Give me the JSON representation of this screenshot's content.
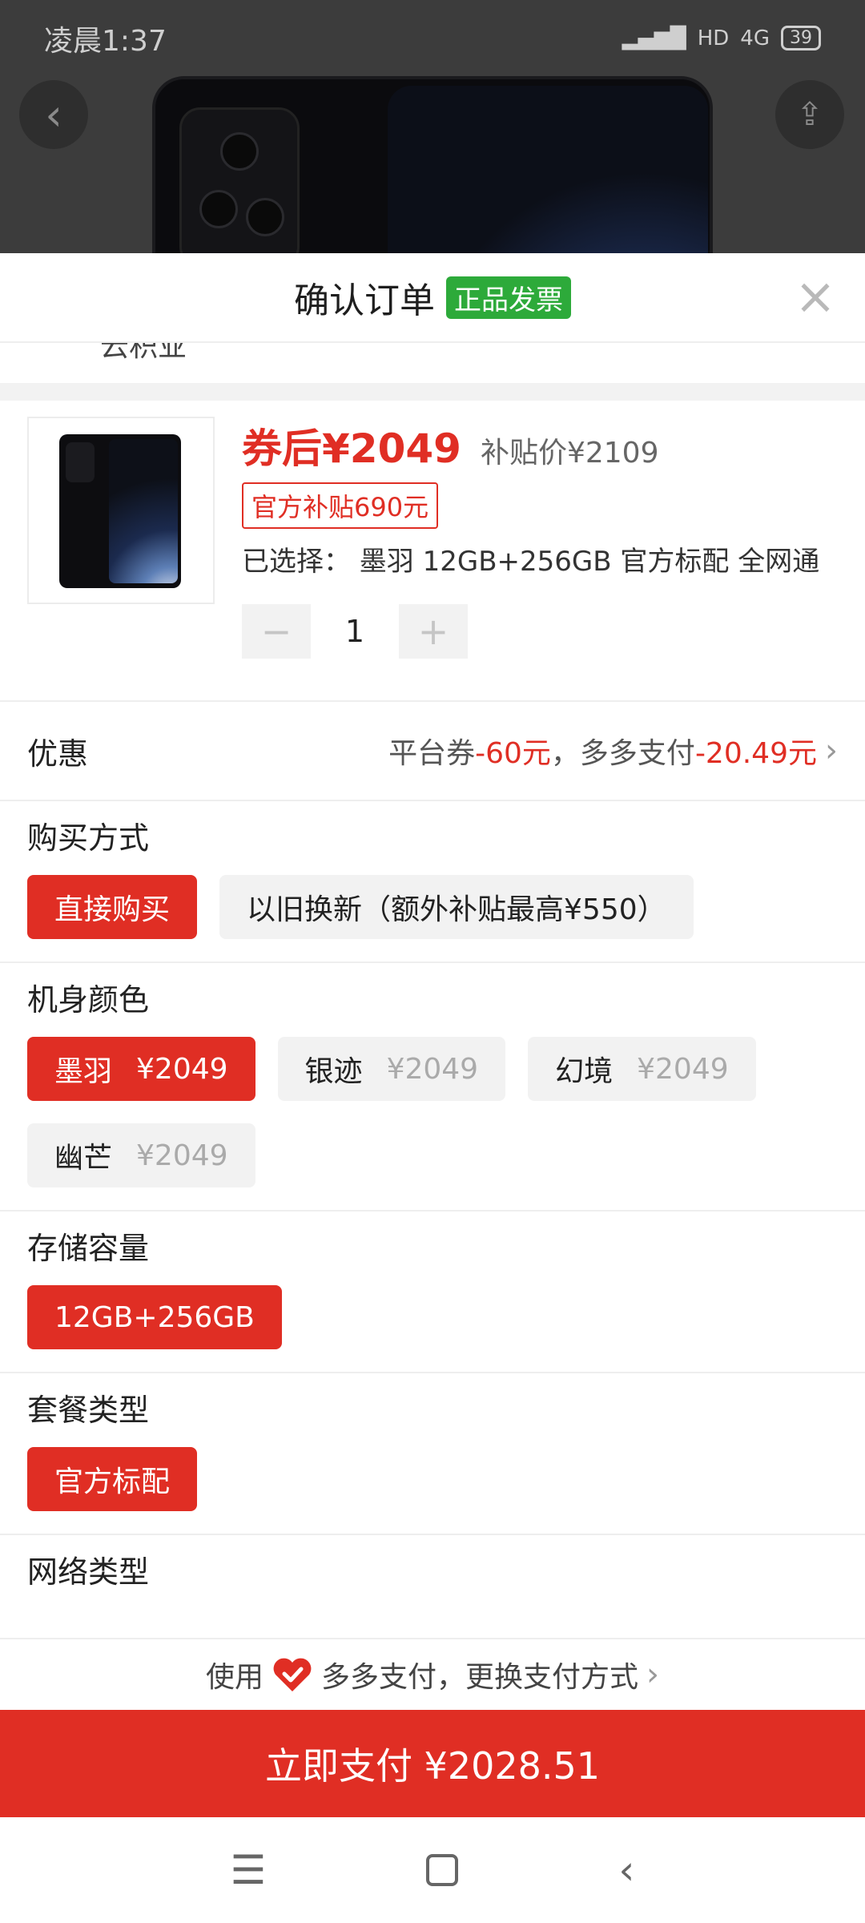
{
  "status_bar": {
    "time": "凌晨1:37",
    "signal_label": "HD",
    "network": "4G",
    "battery": "39"
  },
  "sheet": {
    "title": "确认订单",
    "invoice_badge": "正品发票",
    "cut_text": "云积业"
  },
  "product": {
    "price_label": "券后¥2049",
    "subsidy_price": "补贴价¥2109",
    "subsidy_tag": "官方补贴690元",
    "selected_spec": "已选择： 墨羽 12GB+256GB 官方标配 全网通",
    "quantity": "1",
    "minus": "−",
    "plus": "+"
  },
  "discount": {
    "label": "优惠",
    "coupon_prefix": "平台券",
    "coupon_value": "-60元",
    "pay_prefix": "，多多支付",
    "pay_value": "-20.49元"
  },
  "purchase_method": {
    "title": "购买方式",
    "options": [
      "直接购买",
      "以旧换新（额外补贴最高¥550）"
    ]
  },
  "colors": {
    "title": "机身颜色",
    "options": [
      {
        "name": "墨羽",
        "price": "¥2049"
      },
      {
        "name": "银迹",
        "price": "¥2049"
      },
      {
        "name": "幻境",
        "price": "¥2049"
      },
      {
        "name": "幽芒",
        "price": "¥2049"
      }
    ]
  },
  "storage": {
    "title": "存储容量",
    "options": [
      "12GB+256GB"
    ]
  },
  "package": {
    "title": "套餐类型",
    "options": [
      "官方标配"
    ]
  },
  "network": {
    "title": "网络类型"
  },
  "payment": {
    "prefix": "使用",
    "method": "多多支付，更换支付方式",
    "button": "立即支付 ¥2028.51"
  },
  "theme": {
    "accent": "#e02e24",
    "green": "#2daa3a"
  }
}
